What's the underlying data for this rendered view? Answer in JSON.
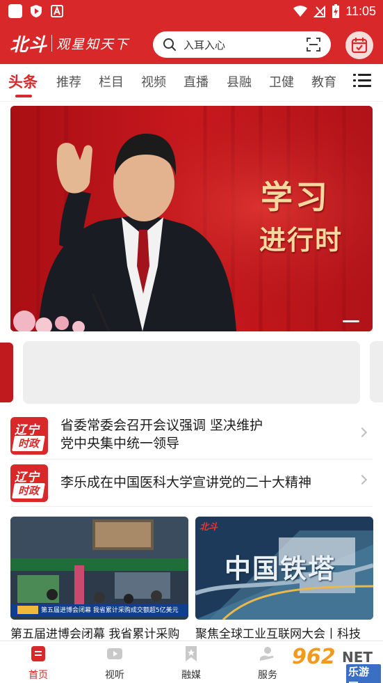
{
  "status_bar": {
    "time": "11:05"
  },
  "header": {
    "logo_main": "北斗",
    "logo_sub": "观星知天下",
    "search_placeholder": "入耳入心"
  },
  "tabs": [
    "头条",
    "推荐",
    "栏目",
    "视频",
    "直播",
    "县融",
    "卫健",
    "教育"
  ],
  "active_tab": "头条",
  "banner": {
    "title": "学习",
    "subtitle": "进行时"
  },
  "news": [
    {
      "badge_top": "辽宁",
      "badge_bottom": "时政",
      "title": "省委常委会召开会议强调 坚决维护党中央集中统一领导"
    },
    {
      "badge_top": "辽宁",
      "badge_bottom": "时政",
      "title": "李乐成在中国医科大学宣讲党的二十大精神"
    }
  ],
  "cards": [
    {
      "title": "第五届进博会闭幕 我省累计采购",
      "caption": "第五届进博会闭幕  我省累计采购成交额超5亿美元"
    },
    {
      "title": "聚焦全球工业互联网大会丨科技",
      "overlay": "中国铁塔",
      "logo": "北斗"
    }
  ],
  "bottom_nav": [
    {
      "label": "首页",
      "icon": "home-doc-icon"
    },
    {
      "label": "视听",
      "icon": "video-play-icon"
    },
    {
      "label": "融媒",
      "icon": "bookmark-icon"
    },
    {
      "label": "服务",
      "icon": "service-hand-icon"
    }
  ],
  "watermark": {
    "num": "962",
    "net": "NET",
    "cn": "乐游网"
  },
  "colors": {
    "brand_red": "#d8282a",
    "banner_gold": "#f7d9a0"
  }
}
